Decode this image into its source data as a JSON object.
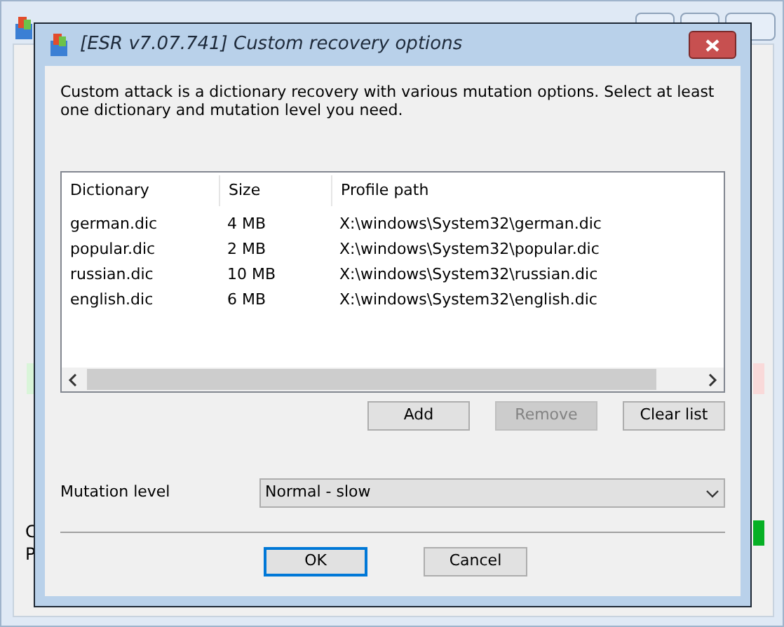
{
  "background_window": {
    "fragments": [
      "C",
      "P"
    ]
  },
  "dialog": {
    "title": "[ESR v7.07.741]  Custom recovery options",
    "description": "Custom attack is a dictionary recovery with various mutation options. Select at least one dictionary and mutation level you need.",
    "table": {
      "columns": [
        "Dictionary",
        "Size",
        "Profile path"
      ],
      "rows": [
        {
          "cells": [
            "german.dic",
            "4 MB",
            "X:\\windows\\System32\\german.dic"
          ]
        },
        {
          "cells": [
            "popular.dic",
            "2 MB",
            "X:\\windows\\System32\\popular.dic"
          ]
        },
        {
          "cells": [
            "russian.dic",
            "10 MB",
            "X:\\windows\\System32\\russian.dic"
          ]
        },
        {
          "cells": [
            "english.dic",
            "6 MB",
            "X:\\windows\\System32\\english.dic"
          ]
        }
      ]
    },
    "list_buttons": [
      {
        "label": "Add",
        "disabled": false
      },
      {
        "label": "Remove",
        "disabled": true
      },
      {
        "label": "Clear list",
        "disabled": false
      }
    ],
    "mutation_level": {
      "label": "Mutation level",
      "value": "Normal - slow"
    },
    "buttons": [
      {
        "label": "OK",
        "default": true
      },
      {
        "label": "Cancel",
        "default": false
      }
    ]
  }
}
